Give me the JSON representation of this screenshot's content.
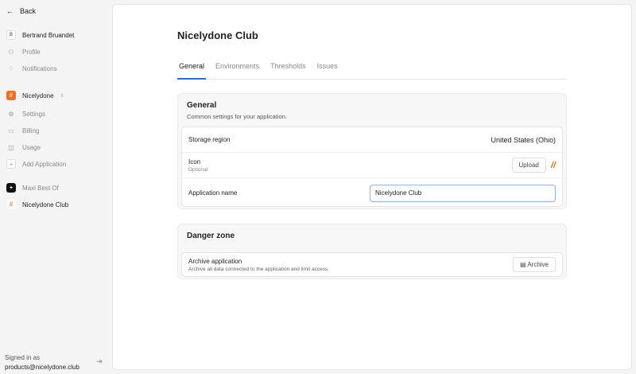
{
  "sidebar": {
    "back": "Back",
    "user": {
      "initial": "B",
      "name": "Bertrand Bruandet"
    },
    "profile": "Profile",
    "notifications": "Notifications",
    "org": "Nicelydone",
    "settings": "Settings",
    "billing": "Billing",
    "usage": "Usage",
    "add_app": "Add Application",
    "apps": [
      "Maxi Best Of",
      "Nicelydone Club"
    ],
    "signed_in_as": "Signed in as",
    "email": "products@nicelydone.club"
  },
  "main": {
    "title": "Nicelydone Club",
    "tabs": [
      "General",
      "Environments",
      "Thresholds",
      "Issues"
    ],
    "general": {
      "title": "General",
      "subtitle": "Common settings for your application.",
      "storage_label": "Storage region",
      "storage_value": "United States (Ohio)",
      "icon_label": "Icon",
      "icon_sub": "Optional",
      "upload": "Upload",
      "appname_label": "Application name",
      "appname_value": "Nicelydone Club"
    },
    "danger": {
      "title": "Danger zone",
      "archive_label": "Archive application",
      "archive_sub": "Archive all data connected to the application and limit access",
      "archive_button": "Archive"
    }
  },
  "colors": {
    "accent": "#2b6be0",
    "brand": "#f36b1c"
  }
}
